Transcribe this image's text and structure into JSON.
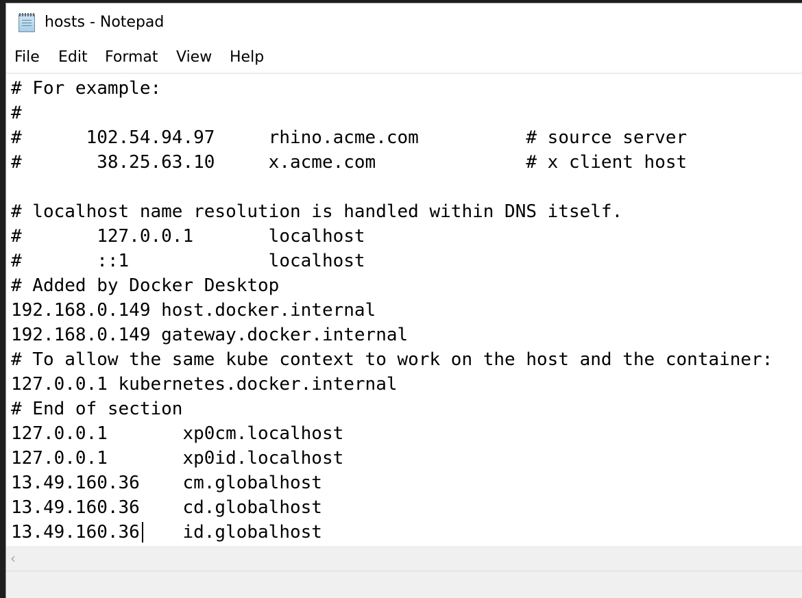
{
  "window": {
    "title": "hosts - Notepad"
  },
  "menu": {
    "file": "File",
    "edit": "Edit",
    "format": "Format",
    "view": "View",
    "help": "Help"
  },
  "editor": {
    "lines": [
      "# For example:",
      "#",
      "#      102.54.94.97     rhino.acme.com          # source server",
      "#       38.25.63.10     x.acme.com              # x client host",
      "",
      "# localhost name resolution is handled within DNS itself.",
      "#       127.0.0.1       localhost",
      "#       ::1             localhost",
      "# Added by Docker Desktop",
      "192.168.0.149 host.docker.internal",
      "192.168.0.149 gateway.docker.internal",
      "# To allow the same kube context to work on the host and the container:",
      "127.0.0.1 kubernetes.docker.internal",
      "# End of section",
      "127.0.0.1       xp0cm.localhost",
      "127.0.0.1       xp0id.localhost",
      "13.49.160.36    cm.globalhost",
      "13.49.160.36    cd.globalhost",
      "13.49.160.36    id.globalhost"
    ]
  },
  "scrollbar": {
    "left_arrow_icon": "chevron-left-icon"
  }
}
